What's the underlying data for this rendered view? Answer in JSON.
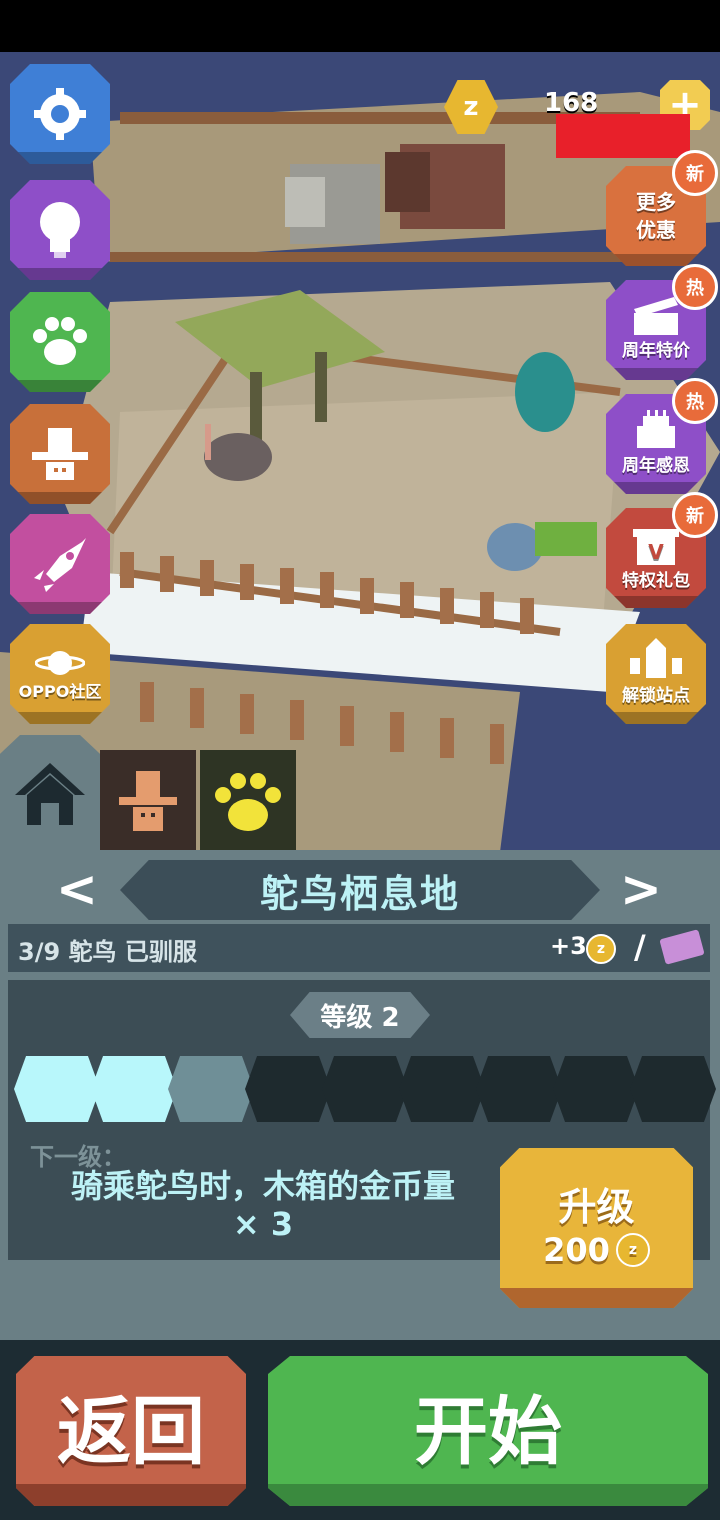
{
  "hud": {
    "coin_symbol": "z",
    "coin_count": "168",
    "plus_label": "+"
  },
  "left_menu": [
    {
      "name": "settings-icon",
      "color": "#3f7fd6"
    },
    {
      "name": "lightbulb-icon",
      "color": "#8e4fc8"
    },
    {
      "name": "paw-icon",
      "color": "#4fb650"
    },
    {
      "name": "cowboy-hat-icon",
      "color": "#c8703a"
    },
    {
      "name": "rocket-icon",
      "color": "#c24f9f"
    },
    {
      "name": "oppo-community-icon",
      "color": "#d9a032",
      "label": "OPPO社区"
    }
  ],
  "right_menu": {
    "more_offers": {
      "label_line1": "更多",
      "label_line2": "优惠",
      "badge": "新",
      "color": "#d9713e"
    },
    "anniversary_deal": {
      "label": "周年特价",
      "badge": "热",
      "color": "#8e4fc8"
    },
    "anniversary_thanks": {
      "label": "周年感恩",
      "badge": "热",
      "color": "#8e4fc8"
    },
    "privilege_pack": {
      "label": "特权礼包",
      "badge": "新",
      "color": "#c24a3e",
      "icon_letter": "V"
    },
    "unlock_sites": {
      "label": "解锁站点",
      "color": "#d9a032"
    }
  },
  "tabs": {
    "home": "home-icon",
    "hat": "cowboy-hat-icon",
    "paw": "paw-icon"
  },
  "panel": {
    "prev_arrow": "<",
    "next_arrow": ">",
    "habitat_title": "鸵鸟栖息地",
    "tamed_text": "3/9 鸵鸟 已驯服",
    "bonus_text": "+3",
    "slash": "/",
    "level_label": "等级 2",
    "progress": {
      "filled": 2,
      "partial": 1,
      "total": 9
    },
    "next_level_label": "下一级：",
    "next_level_desc_line1": "骑乘鸵鸟时，木箱的金币量",
    "next_level_desc_line2": "× 3",
    "upgrade_label": "升级",
    "upgrade_cost": "200"
  },
  "buttons": {
    "back": "返回",
    "start": "开始"
  }
}
